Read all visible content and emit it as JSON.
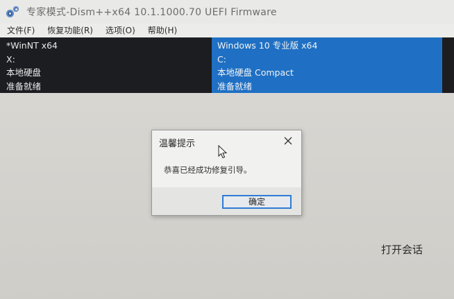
{
  "window": {
    "title": "专家模式-Dism++x64 10.1.1000.70 UEFI Firmware",
    "icon": "gears-icon"
  },
  "menu": {
    "items": [
      {
        "label": "文件(F)"
      },
      {
        "label": "恢复功能(R)"
      },
      {
        "label": "选项(O)"
      },
      {
        "label": "帮助(H)"
      }
    ]
  },
  "systems": [
    {
      "name": "*WinNT x64",
      "drive": "X:",
      "disk": "本地硬盘",
      "status": "准备就绪",
      "selected": false
    },
    {
      "name": "Windows 10 专业版 x64",
      "drive": "C:",
      "disk": "本地硬盘 Compact",
      "status": "准备就绪",
      "selected": true
    }
  ],
  "dialog": {
    "title": "温馨提示",
    "message": "恭喜已经成功修复引导。",
    "ok_label": "确定",
    "close_icon": "close-icon"
  },
  "main": {
    "open_session_label": "打开会话"
  },
  "colors": {
    "selection": "#1f70c4",
    "panel_dark": "#1b1d21",
    "button_border": "#2f7ad6"
  }
}
